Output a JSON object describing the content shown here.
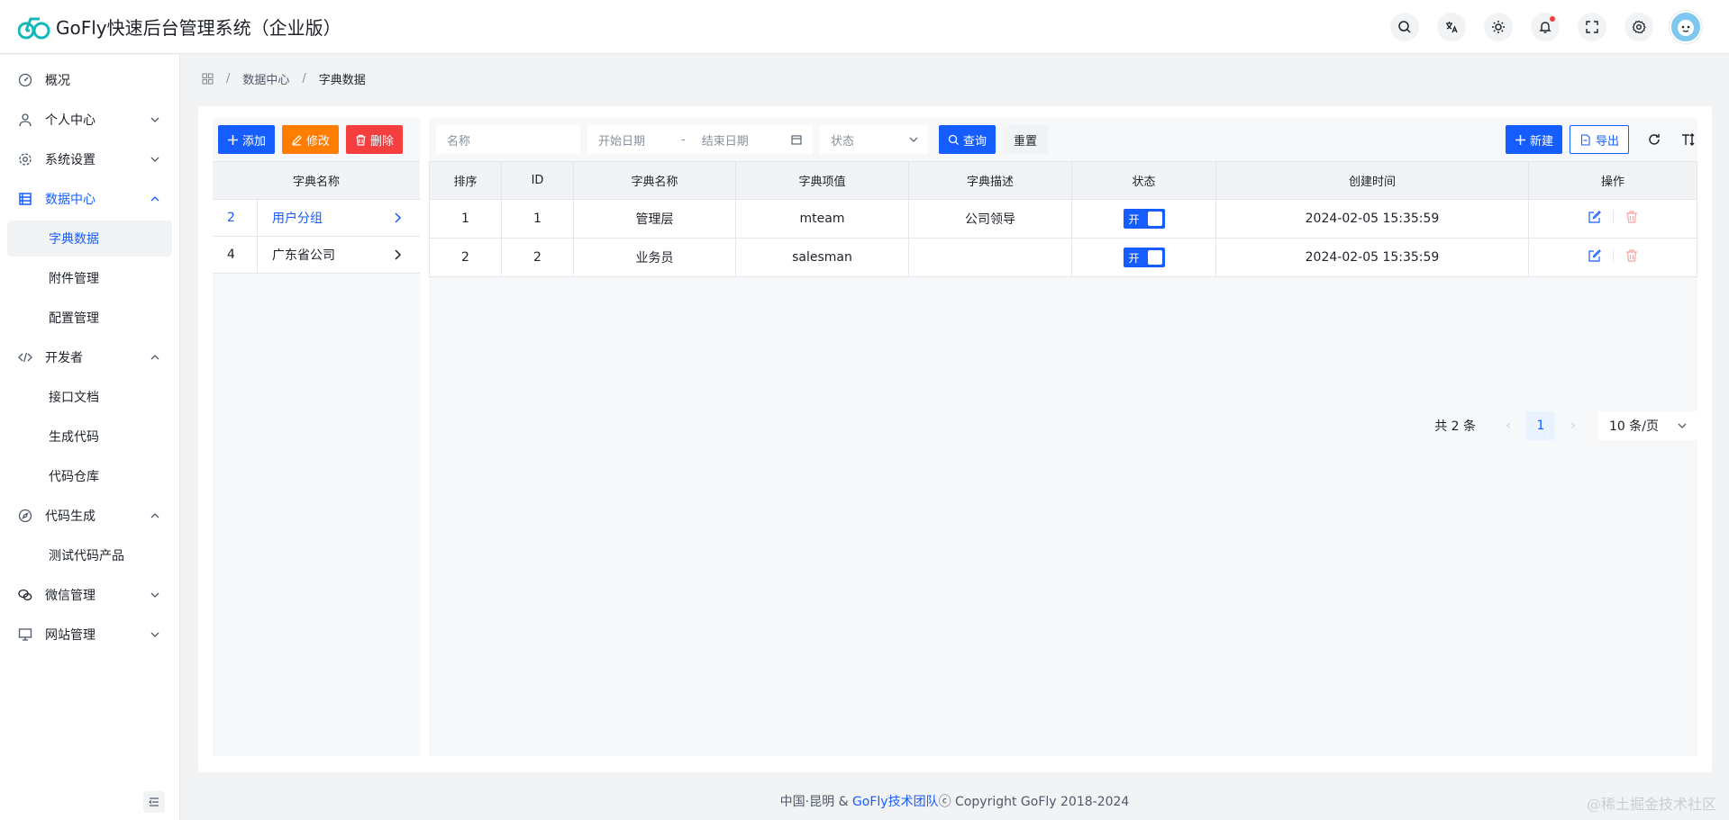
{
  "app": {
    "title": "GoFly快速后台管理系统（企业版）"
  },
  "header_icons": [
    "search-icon",
    "translate-icon",
    "theme-icon",
    "bell-icon",
    "fullscreen-icon",
    "gear-icon"
  ],
  "sidebar": {
    "items": [
      {
        "label": "概况",
        "icon": "dashboard-icon"
      },
      {
        "label": "个人中心",
        "icon": "user-icon"
      },
      {
        "label": "系统设置",
        "icon": "settings-icon"
      },
      {
        "label": "数据中心",
        "icon": "database-icon",
        "children": [
          "字典数据",
          "附件管理",
          "配置管理"
        ]
      },
      {
        "label": "开发者",
        "icon": "code-icon",
        "children": [
          "接口文档",
          "生成代码",
          "代码仓库"
        ]
      },
      {
        "label": "代码生成",
        "icon": "compass-icon",
        "children": [
          "测试代码产品"
        ]
      },
      {
        "label": "微信管理",
        "icon": "wechat-icon"
      },
      {
        "label": "网站管理",
        "icon": "monitor-icon"
      }
    ]
  },
  "breadcrumb": {
    "items": [
      "数据中心",
      "字典数据"
    ]
  },
  "left_panel": {
    "buttons": {
      "add": "添加",
      "edit": "修改",
      "delete": "删除"
    },
    "column": "字典名称",
    "rows": [
      {
        "idx": "2",
        "name": "用户分组"
      },
      {
        "idx": "4",
        "name": "广东省公司"
      }
    ]
  },
  "filters": {
    "name_placeholder": "名称",
    "start_date_placeholder": "开始日期",
    "date_sep": "-",
    "end_date_placeholder": "结束日期",
    "status_placeholder": "状态",
    "query": "查询",
    "reset": "重置",
    "new": "新建",
    "export": "导出"
  },
  "table": {
    "columns": [
      "排序",
      "ID",
      "字典名称",
      "字典项值",
      "字典描述",
      "状态",
      "创建时间",
      "操作"
    ],
    "rows": [
      {
        "sort": "1",
        "id": "1",
        "name": "管理层",
        "value": "mteam",
        "desc": "公司领导",
        "status": "开",
        "created": "2024-02-05 15:35:59"
      },
      {
        "sort": "2",
        "id": "2",
        "name": "业务员",
        "value": "salesman",
        "desc": "",
        "status": "开",
        "created": "2024-02-05 15:35:59"
      }
    ]
  },
  "pagination": {
    "total": "共 2 条",
    "current": "1",
    "page_size": "10 条/页"
  },
  "footer": {
    "prefix": "中国·昆明 & ",
    "team": "GoFly技术团队",
    "copyright": "ⓒ Copyright GoFly 2018-2024"
  },
  "watermark": "@稀土掘金技术社区",
  "colors": {
    "primary": "#165dff",
    "warning": "#ff7d00",
    "danger": "#f53f3f"
  }
}
